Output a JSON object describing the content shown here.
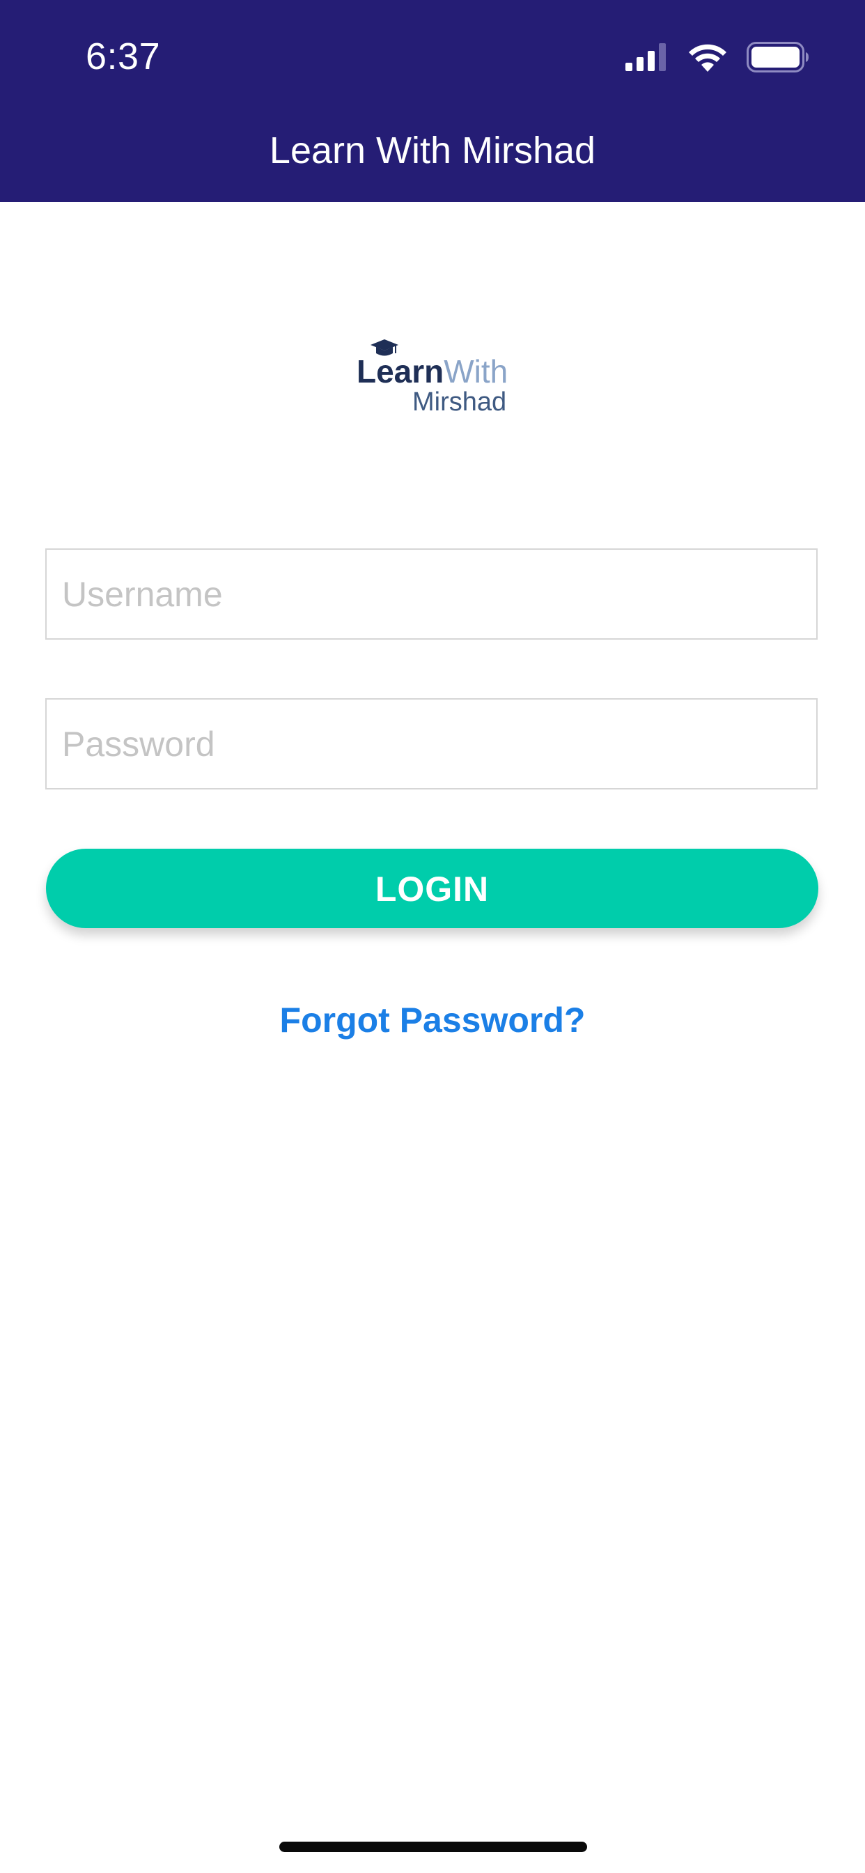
{
  "status_bar": {
    "time": "6:37",
    "icons": [
      "signal-icon",
      "wifi-icon",
      "battery-icon"
    ]
  },
  "nav": {
    "title": "Learn With Mirshad"
  },
  "logo": {
    "learn": "Learn",
    "with": "With",
    "mirshad": "Mirshad",
    "icon": "graduation-cap-icon"
  },
  "form": {
    "username_placeholder": "Username",
    "username_value": "",
    "password_placeholder": "Password",
    "password_value": "",
    "login_label": "LOGIN",
    "forgot_label": "Forgot Password?"
  },
  "colors": {
    "header_bg": "#251d75",
    "button_bg": "#00cdab",
    "link": "#1b7fe6"
  }
}
